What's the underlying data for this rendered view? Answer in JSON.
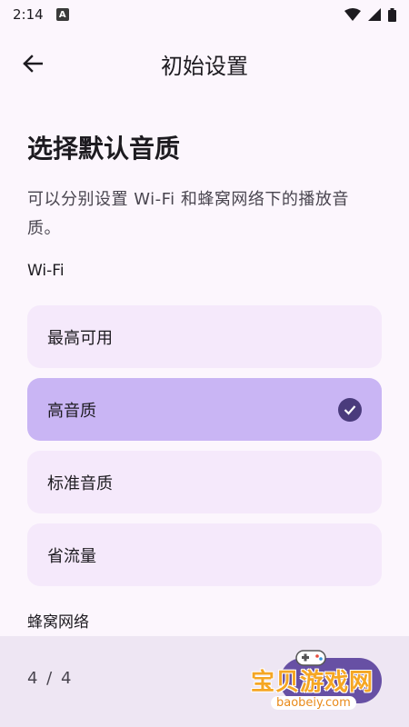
{
  "status_bar": {
    "time": "2:14",
    "app_icon_letter": "A"
  },
  "app_bar": {
    "title": "初始设置"
  },
  "content": {
    "heading": "选择默认音质",
    "description": "可以分别设置 Wi-Fi 和蜂窝网络下的播放音质。",
    "wifi_label": "Wi-Fi",
    "cellular_label": "蜂窝网络",
    "wifi_options": [
      {
        "label": "最高可用",
        "selected": false
      },
      {
        "label": "高音质",
        "selected": true
      },
      {
        "label": "标准音质",
        "selected": false
      },
      {
        "label": "省流量",
        "selected": false
      }
    ]
  },
  "bottom_bar": {
    "page_indicator": "4 / 4"
  },
  "watermark": {
    "text": "宝贝游戏网",
    "url": "baobeiy.com"
  },
  "colors": {
    "background": "#fcf6fd",
    "option_bg": "#f5e9fb",
    "option_selected_bg": "#c9b5f4",
    "check_bg": "#4a3b7c",
    "accent": "#6750a4"
  }
}
